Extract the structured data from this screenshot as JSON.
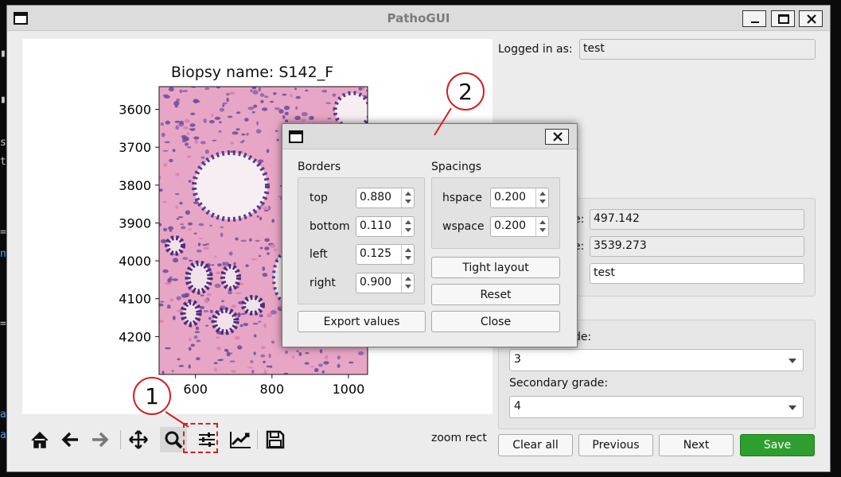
{
  "window": {
    "title": "PathoGUI"
  },
  "figure": {
    "title": "Biopsy name: S142_F",
    "x_ticks": [
      "600",
      "800",
      "1000"
    ],
    "y_ticks": [
      "3600",
      "3700",
      "3800",
      "3900",
      "4000",
      "4100",
      "4200"
    ]
  },
  "chart_data": {
    "type": "heatmap",
    "title": "Biopsy name: S142_F",
    "xlabel": "",
    "ylabel": "",
    "x_ticks": [
      600,
      800,
      1000
    ],
    "y_ticks": [
      3600,
      3700,
      3800,
      3900,
      4000,
      4100,
      4200
    ],
    "xlim": [
      505,
      1050
    ],
    "ylim": [
      4300,
      3540
    ],
    "content": "H&E stained tissue image"
  },
  "toolbar": {
    "icons": [
      "home-icon",
      "back-icon",
      "forward-icon",
      "pan-icon",
      "zoom-icon",
      "subplots-icon",
      "axes-edit-icon",
      "save-icon"
    ],
    "status": "zoom rect"
  },
  "panel": {
    "logged_in_label": "Logged in as:",
    "logged_in_value": "test",
    "info_labels": [
      "e:",
      "e:"
    ],
    "field1_value": "497.142",
    "field2_value": "3539.273",
    "field3_value": "test",
    "primary_grade_label_tail": "de:",
    "primary_grade_value": "3",
    "secondary_grade_label": "Secondary grade:",
    "secondary_grade_value": "4"
  },
  "buttons": {
    "clear_all": "Clear all",
    "previous": "Previous",
    "next": "Next",
    "save": "Save"
  },
  "dialog": {
    "borders_title": "Borders",
    "spacings_title": "Spacings",
    "borders": [
      {
        "label": "top",
        "value": "0.880"
      },
      {
        "label": "bottom",
        "value": "0.110"
      },
      {
        "label": "left",
        "value": "0.125"
      },
      {
        "label": "right",
        "value": "0.900"
      }
    ],
    "spacings": [
      {
        "label": "hspace",
        "value": "0.200"
      },
      {
        "label": "wspace",
        "value": "0.200"
      }
    ],
    "tight_layout": "Tight layout",
    "reset": "Reset",
    "export_values": "Export values",
    "close": "Close"
  },
  "annotations": {
    "callout_1": "1",
    "callout_2": "2"
  },
  "colors": {
    "accent_red": "#d32020",
    "save_green": "#2e9e2e",
    "tissue_pink": "#e8a6c6",
    "nuclei_purple": "#5b3c8c"
  }
}
